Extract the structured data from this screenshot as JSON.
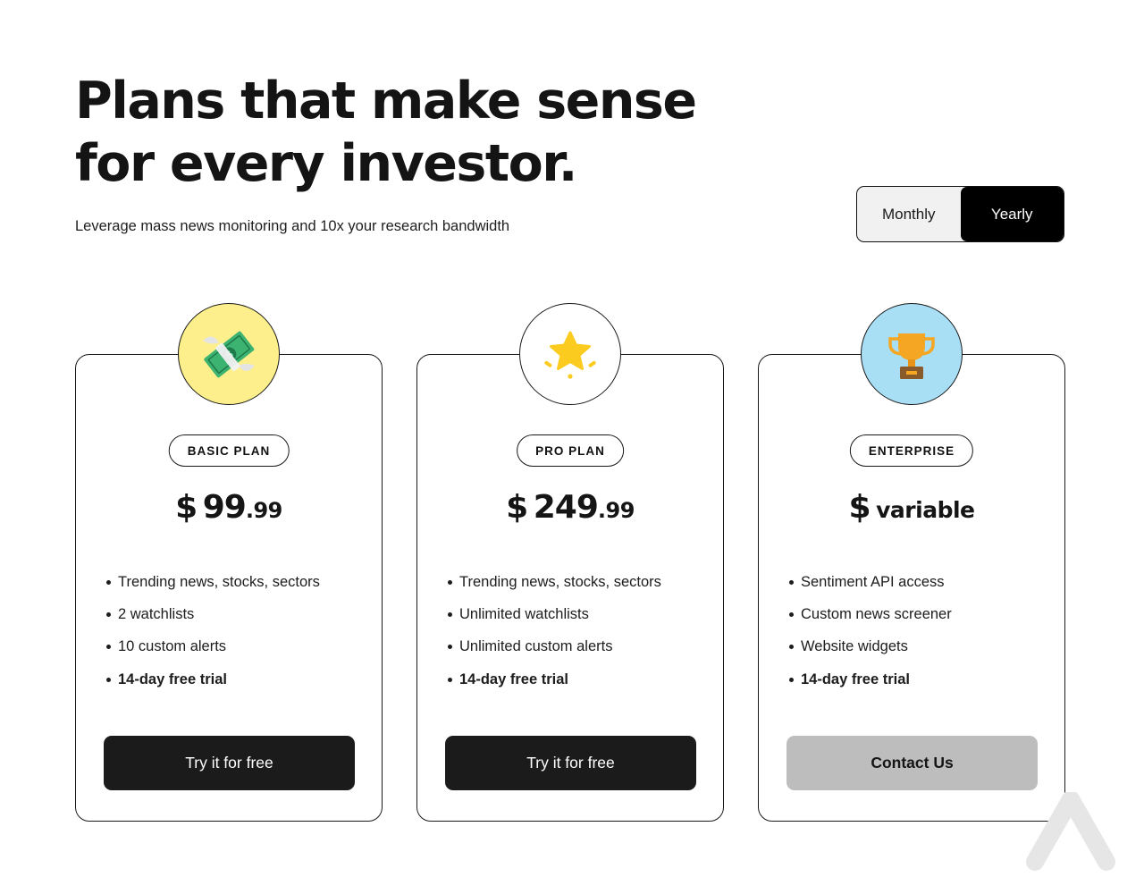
{
  "header": {
    "headline_line1": "Plans that make sense",
    "headline_line2": "for every investor.",
    "subheadline": "Leverage mass news monitoring and 10x your research bandwidth"
  },
  "billing_toggle": {
    "options": [
      "Monthly",
      "Yearly"
    ],
    "selected": "Yearly"
  },
  "plans": [
    {
      "icon": "money-with-wings-icon",
      "icon_bg": "#fdef8c",
      "name": "BASIC PLAN",
      "currency": "$",
      "price_whole": "99",
      "price_cents": ".99",
      "features": [
        "Trending news, stocks, sectors",
        "2 watchlists",
        "10 custom alerts",
        "14-day free trial"
      ],
      "cta": "Try it for free"
    },
    {
      "icon": "star-icon",
      "icon_bg": "#ffffff",
      "name": "PRO PLAN",
      "currency": "$",
      "price_whole": "249",
      "price_cents": ".99",
      "features": [
        "Trending news, stocks, sectors",
        "Unlimited watchlists",
        "Unlimited custom alerts",
        "14-day free trial"
      ],
      "cta": "Try it for free"
    },
    {
      "icon": "trophy-icon",
      "icon_bg": "#a9dff5",
      "name": "ENTERPRISE",
      "currency": "$",
      "price_word": "variable",
      "features": [
        "Sentiment API access",
        "Custom news screener",
        "Website widgets",
        "14-day free trial"
      ],
      "cta": "Contact Us"
    }
  ],
  "colors": {
    "primary_button": "#1b1b1b",
    "secondary_button": "#bdbdbd",
    "border": "#1a1a1a"
  }
}
